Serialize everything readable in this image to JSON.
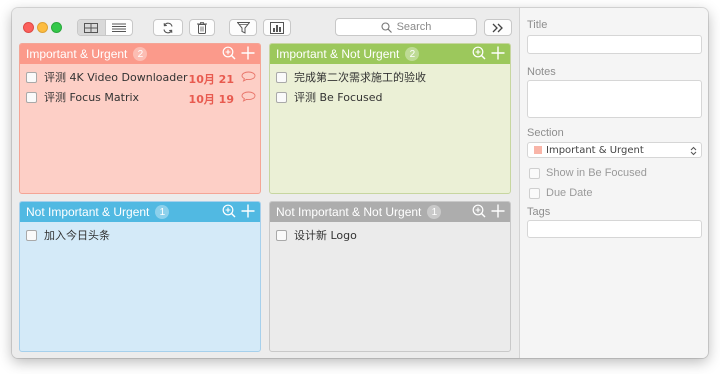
{
  "toolbar": {
    "search_placeholder": "Search",
    "icons": [
      "grid-view-icon",
      "list-view-icon",
      "sync-icon",
      "trash-icon",
      "filter-icon",
      "chart-icon",
      "expand-icon"
    ]
  },
  "quadrants": [
    {
      "title": "Important & Urgent",
      "count": "2",
      "color": "#fb9a8b",
      "tasks": [
        {
          "title": "评测 4K Video Downloader",
          "date": "10月 21",
          "has_note": true
        },
        {
          "title": "评测 Focus Matrix",
          "date": "10月 19",
          "has_note": true
        }
      ]
    },
    {
      "title": "Important & Not Urgent",
      "count": "2",
      "color": "#9cc85c",
      "tasks": [
        {
          "title": "完成第二次需求施工的验收"
        },
        {
          "title": "评测 Be Focused"
        }
      ]
    },
    {
      "title": "Not Important & Urgent",
      "count": "1",
      "color": "#51b9e2",
      "tasks": [
        {
          "title": "加入今日头条"
        }
      ]
    },
    {
      "title": "Not Important & Not Urgent",
      "count": "1",
      "color": "#adadad",
      "tasks": [
        {
          "title": "设计新 Logo"
        }
      ]
    }
  ],
  "inspector": {
    "title_label": "Title",
    "notes_label": "Notes",
    "section_label": "Section",
    "section_value": "Important & Urgent",
    "show_in_be_focused_label": "Show in Be Focused",
    "due_date_label": "Due Date",
    "tags_label": "Tags"
  }
}
